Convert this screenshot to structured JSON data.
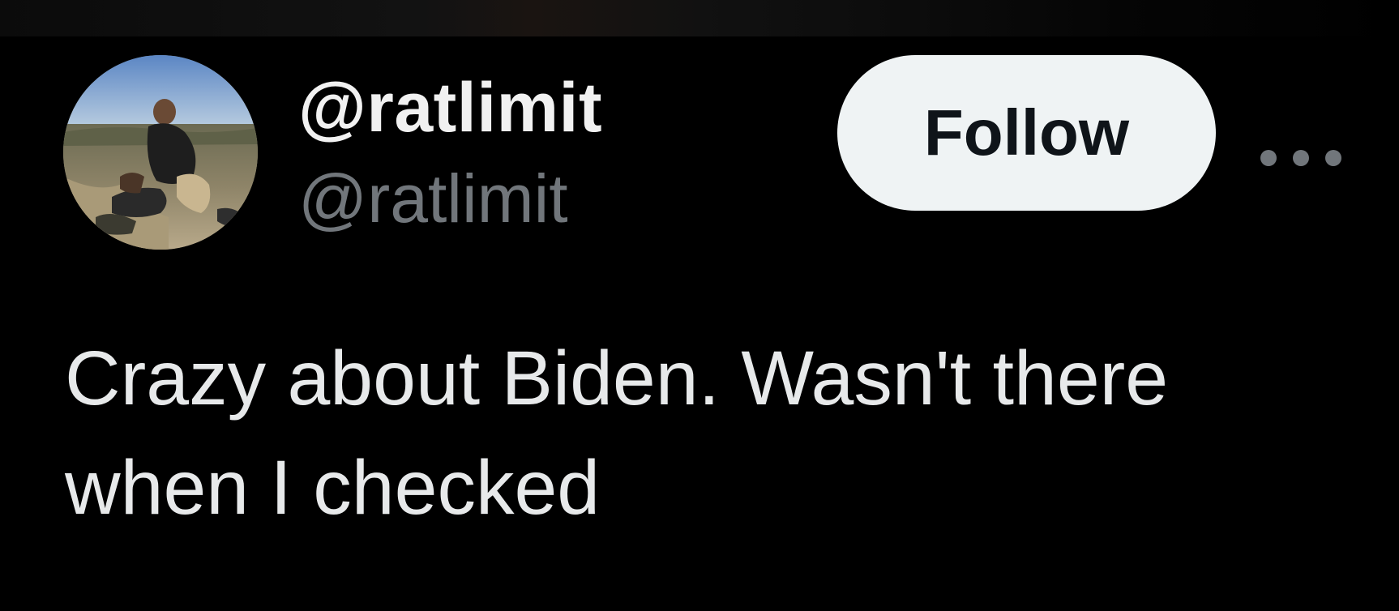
{
  "tweet": {
    "display_name": "@ratlimit",
    "handle": "@ratlimit",
    "follow_label": "Follow",
    "text": "Crazy about Biden. Wasn't there when I checked",
    "more_icon": "more-horizontal-icon"
  },
  "colors": {
    "background": "#000000",
    "text_primary": "#e7e9ea",
    "text_secondary": "#71767b",
    "button_bg": "#eff3f4",
    "button_text": "#0f1419"
  }
}
